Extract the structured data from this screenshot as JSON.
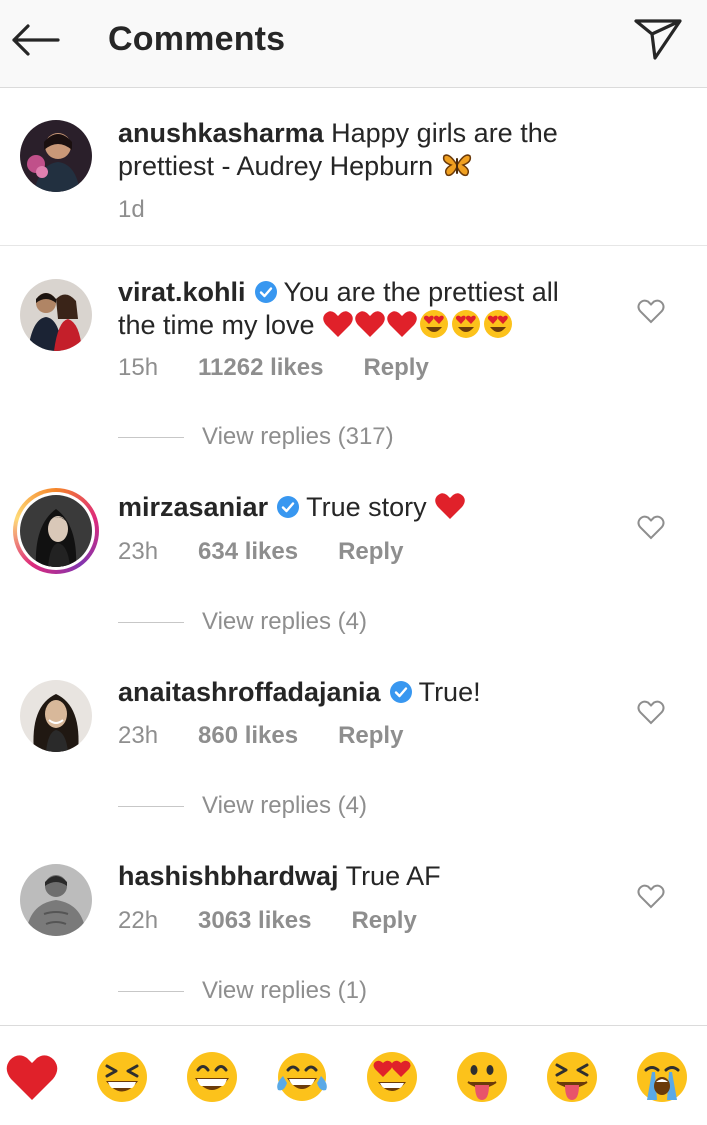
{
  "header": {
    "title": "Comments",
    "back_icon": "arrow-left-icon",
    "share_icon": "paper-plane-icon"
  },
  "caption": {
    "username": "anushkasharma",
    "text": "Happy girls are the prettiest - Audrey Hepburn",
    "time": "1d"
  },
  "comments": [
    {
      "username": "virat.kohli",
      "verified": true,
      "text_line1": "You are the prettiest all",
      "text_line2": "the time my love",
      "time": "15h",
      "likes": "11262 likes",
      "reply_label": "Reply",
      "view_replies": "View replies (317)"
    },
    {
      "username": "mirzasaniar",
      "verified": true,
      "text": "True story",
      "time": "23h",
      "likes": "634 likes",
      "reply_label": "Reply",
      "view_replies": "View replies (4)"
    },
    {
      "username": "anaitashroffadajania",
      "verified": true,
      "text": "True!",
      "time": "23h",
      "likes": "860 likes",
      "reply_label": "Reply",
      "view_replies": "View replies (4)"
    },
    {
      "username": "hashishbhardwaj",
      "verified": false,
      "text": "True AF",
      "time": "22h",
      "likes": "3063 likes",
      "reply_label": "Reply",
      "view_replies": "View replies (1)"
    }
  ],
  "emoji_bar": [
    "red-heart",
    "laughing-squint",
    "grinning",
    "tears-of-joy",
    "heart-eyes",
    "tongue-out",
    "squinting-tongue",
    "loudly-crying"
  ],
  "colors": {
    "accent_blue": "#3897f0",
    "heart_red": "#ed1c24",
    "meta_gray": "#8e8e8e",
    "text": "#262626"
  }
}
